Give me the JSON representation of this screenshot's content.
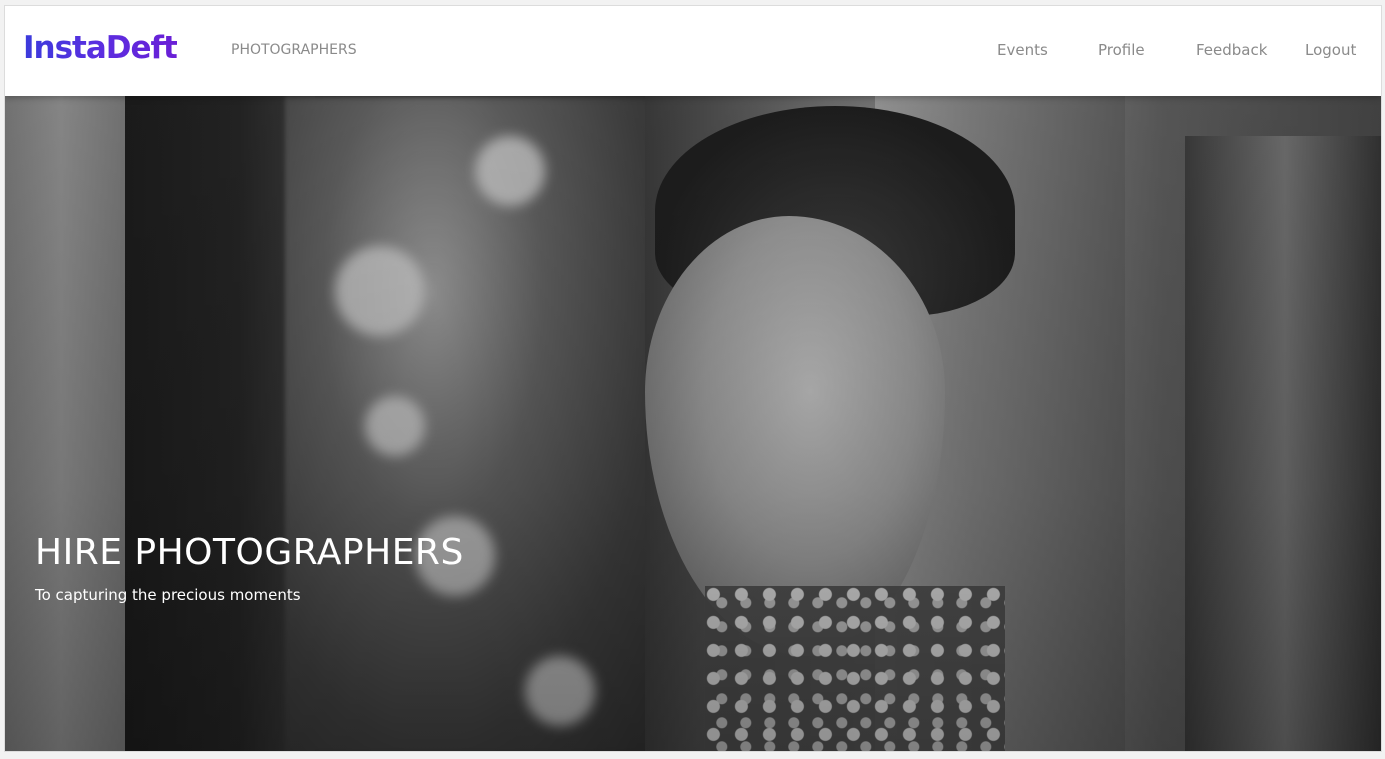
{
  "navbar": {
    "brand": "InstaDeft",
    "section": "PHOTOGRAPHERS",
    "items": [
      {
        "label": "Events"
      },
      {
        "label": "Profile"
      },
      {
        "label": "Feedback"
      },
      {
        "label": "Logout"
      }
    ]
  },
  "hero": {
    "title": "HIRE PHOTOGRAPHERS",
    "subtitle": "To capturing the precious moments",
    "image": "black-and-white-bride-photo"
  },
  "colors": {
    "brand_gradient_start": "#3b3bdc",
    "brand_gradient_end": "#6a1fd6",
    "nav_text": "#8a8a8a",
    "hero_text": "#ffffff"
  }
}
